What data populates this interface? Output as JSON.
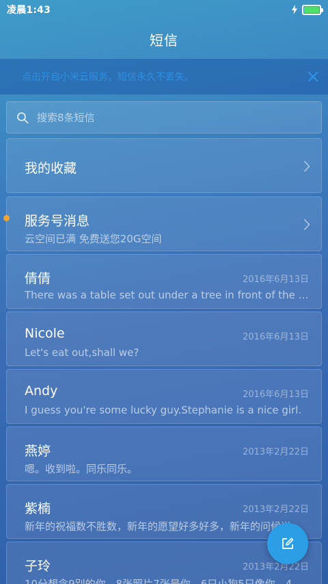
{
  "status_bar": {
    "time": "凌晨1:43",
    "battery_level": 1.0,
    "battery_color": "#4ee06a"
  },
  "header": {
    "title": "短信"
  },
  "notice": {
    "text": "点击开启小米云服务，短信永久不丢失。",
    "close_icon": "close-icon"
  },
  "search": {
    "placeholder": "搜索8条短信",
    "icon": "search-icon"
  },
  "favorites": {
    "label": "我的收藏"
  },
  "service": {
    "name": "服务号消息",
    "preview": "云空间已满 免费送您20G空间",
    "unread_color": "#f2a52e"
  },
  "conversations": [
    {
      "name": "倩倩",
      "date": "2016年6月13日",
      "preview": "There was a table set out under a tree in front of the house, and the March Hare"
    },
    {
      "name": "Nicole",
      "date": "2016年6月13日",
      "preview": "Let's eat out,shall we?"
    },
    {
      "name": "Andy",
      "date": "2016年6月13日",
      "preview": "I guess you're some lucky guy.Stephanie is a nice girl."
    },
    {
      "name": "燕婷",
      "date": "2013年2月22日",
      "preview": "嗯。收到啦。同乐同乐。"
    },
    {
      "name": "紫楠",
      "date": "2013年2月22日",
      "preview": "新年的祝福数不胜数，新年的愿望好多好多，新年的问候送给你"
    },
    {
      "name": "子玲",
      "date": "2013年2月22日",
      "preview": "10分想念9别的你，8张照片7张是你，6只小狗5只像你，4..."
    }
  ],
  "fab": {
    "icon": "compose-icon",
    "color": "#2b9ee6"
  }
}
